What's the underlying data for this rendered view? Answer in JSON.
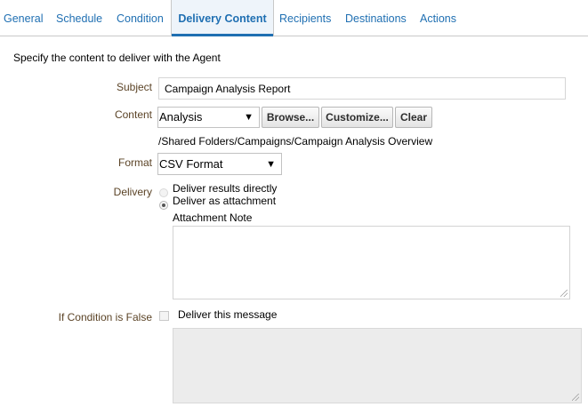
{
  "tabs": [
    {
      "label": "General"
    },
    {
      "label": "Schedule"
    },
    {
      "label": "Condition"
    },
    {
      "label": "Delivery Content",
      "active": true
    },
    {
      "label": "Recipients"
    },
    {
      "label": "Destinations"
    },
    {
      "label": "Actions"
    }
  ],
  "intro": "Specify the content to deliver with the Agent",
  "subject": {
    "label": "Subject",
    "value": "Campaign Analysis Report"
  },
  "content": {
    "label": "Content",
    "selected": "Analysis",
    "browse_label": "Browse...",
    "customize_label": "Customize...",
    "clear_label": "Clear",
    "path": "/Shared Folders/Campaigns/Campaign Analysis Overview"
  },
  "format": {
    "label": "Format",
    "selected": "CSV Format"
  },
  "delivery": {
    "label": "Delivery",
    "option_direct": "Deliver results directly",
    "option_attachment": "Deliver as attachment",
    "selected": "attachment",
    "attachment_note_label": "Attachment Note",
    "attachment_note_value": ""
  },
  "condition_false": {
    "label": "If Condition is False",
    "checkbox_label": "Deliver this message",
    "checked": false,
    "message_value": ""
  },
  "icons": {
    "dropdown": "▼"
  },
  "colors": {
    "tab_link": "#1f6fb2",
    "label": "#5b4326"
  }
}
